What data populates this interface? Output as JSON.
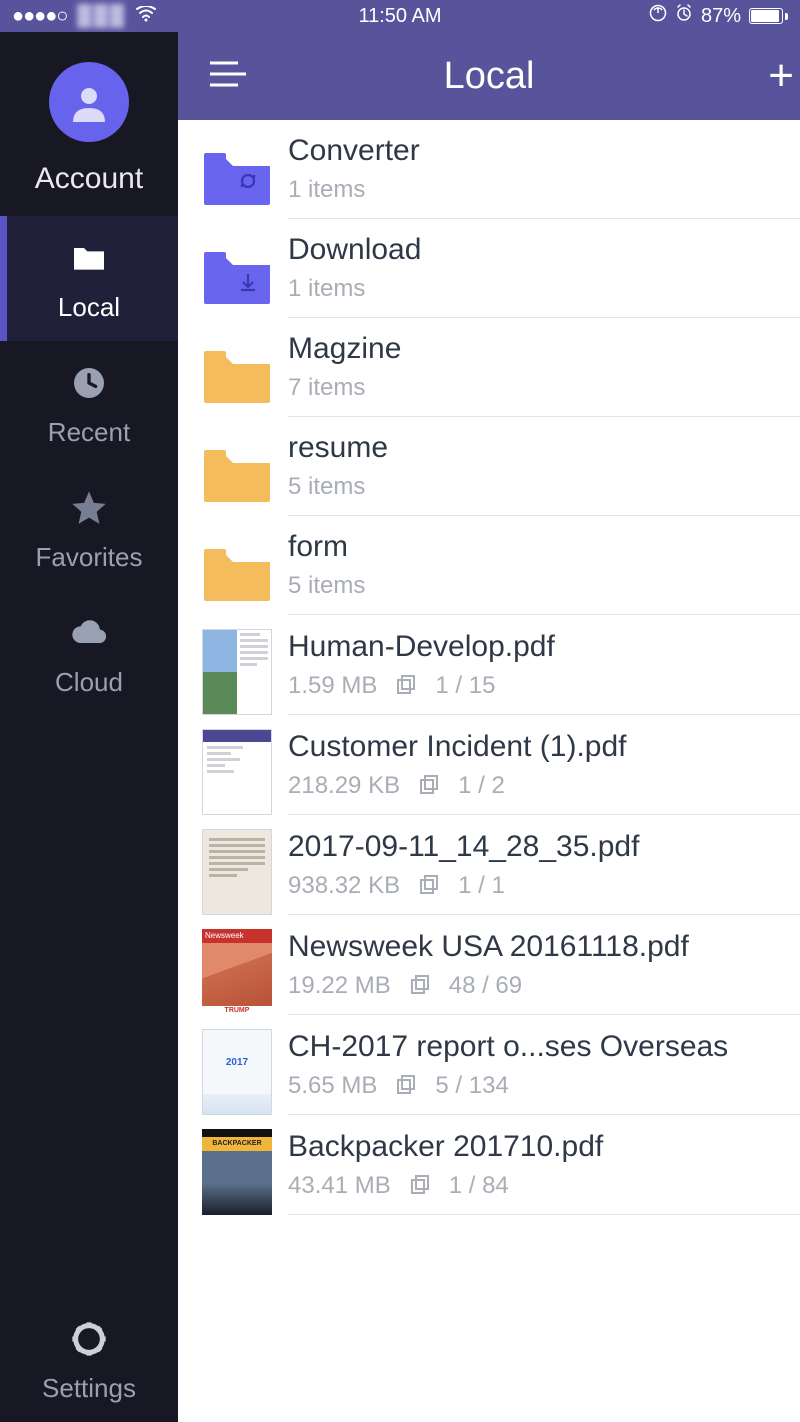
{
  "statusbar": {
    "time": "11:50 AM",
    "battery_pct": "87%"
  },
  "sidebar": {
    "account_label": "Account",
    "items": [
      {
        "label": "Local"
      },
      {
        "label": "Recent"
      },
      {
        "label": "Favorites"
      },
      {
        "label": "Cloud"
      }
    ],
    "settings_label": "Settings"
  },
  "topbar": {
    "title": "Local"
  },
  "folders": [
    {
      "name": "Converter",
      "subtitle": "1 items",
      "color": "blue",
      "badge": "sync"
    },
    {
      "name": "Download",
      "subtitle": "1 items",
      "color": "blue",
      "badge": "download"
    },
    {
      "name": "Magzine",
      "subtitle": "7 items",
      "color": "orange",
      "badge": ""
    },
    {
      "name": "resume",
      "subtitle": "5 items",
      "color": "orange",
      "badge": ""
    },
    {
      "name": "form",
      "subtitle": "5 items",
      "color": "orange",
      "badge": ""
    }
  ],
  "files": [
    {
      "name": "Human-Develop.pdf",
      "size": "1.59 MB",
      "pages": "1 / 15",
      "thumb": "book"
    },
    {
      "name": "Customer Incident (1).pdf",
      "size": "218.29 KB",
      "pages": "1 / 2",
      "thumb": "form"
    },
    {
      "name": "2017-09-11_14_28_35.pdf",
      "size": "938.32 KB",
      "pages": "1 / 1",
      "thumb": "scan"
    },
    {
      "name": "Newsweek USA 20161118.pdf",
      "size": "19.22 MB",
      "pages": "48 / 69",
      "thumb": "newsweek"
    },
    {
      "name": "CH-2017 report o...ses Overseas",
      "size": "5.65 MB",
      "pages": "5 / 134",
      "thumb": "report"
    },
    {
      "name": "Backpacker 201710.pdf",
      "size": "43.41 MB",
      "pages": "1 / 84",
      "thumb": "backpacker"
    }
  ]
}
